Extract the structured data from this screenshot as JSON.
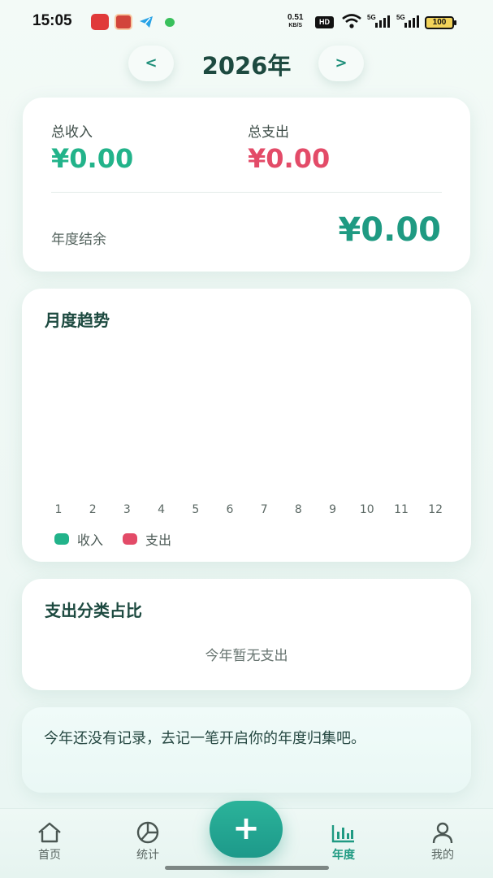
{
  "status_bar": {
    "time": "15:05",
    "net_speed": "0.51",
    "net_unit": "KB/S",
    "hd": "HD",
    "battery": "100",
    "icons": [
      "xiaohongshu-app-icon",
      "food-app-icon",
      "telegram-icon",
      "wechat-icon",
      "wifi-icon",
      "signal-5g-icon",
      "signal-5g-icon"
    ]
  },
  "header": {
    "prev": "<",
    "year": "2026年",
    "next": ">"
  },
  "summary": {
    "income_label": "总收入",
    "income_value": "¥0.00",
    "expense_label": "总支出",
    "expense_value": "¥0.00",
    "balance_label": "年度结余",
    "balance_value": "¥0.00"
  },
  "trend": {
    "title": "月度趋势",
    "months": [
      "1",
      "2",
      "3",
      "4",
      "5",
      "6",
      "7",
      "8",
      "9",
      "10",
      "11",
      "12"
    ],
    "legend": [
      {
        "label": "收入",
        "color": "#22b38a"
      },
      {
        "label": "支出",
        "color": "#e34b68"
      }
    ]
  },
  "category": {
    "title": "支出分类占比",
    "empty": "今年暂无支出"
  },
  "tip": {
    "text": "今年还没有记录，去记一笔开启你的年度归集吧。"
  },
  "bottom_nav": {
    "items": [
      {
        "label": "首页",
        "icon": "home-icon"
      },
      {
        "label": "统计",
        "icon": "pie-chart-icon"
      },
      {
        "label": "年度",
        "icon": "bar-chart-icon",
        "active": true
      },
      {
        "label": "我的",
        "icon": "user-icon"
      }
    ],
    "add": "+"
  },
  "colors": {
    "accent": "#1f9a82",
    "income": "#22b38a",
    "expense": "#e34b68"
  }
}
